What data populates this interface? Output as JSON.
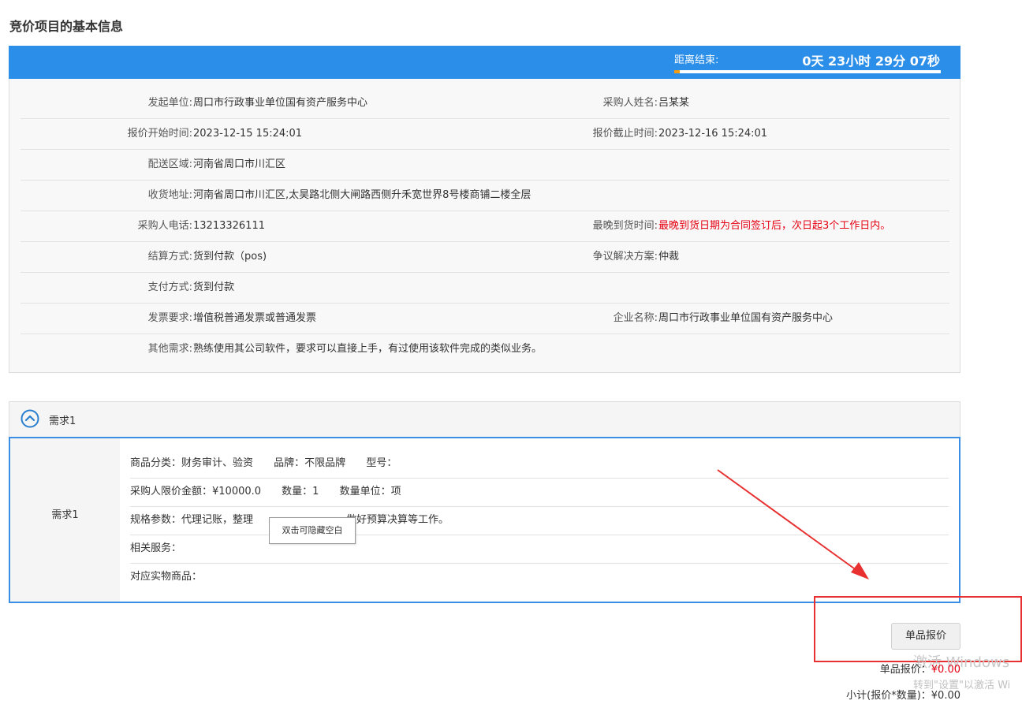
{
  "page_title": "竞价项目的基本信息",
  "countdown": {
    "label": "距离结束:",
    "time": "0天 23小时 29分 07秒",
    "elapsed_fraction": 0.02,
    "colors": {
      "banner": "#2b8ee8",
      "progress": "#f39c12"
    }
  },
  "info": [
    {
      "l_label": "发起单位:",
      "l_value": "周口市行政事业单位国有资产服务中心",
      "r_label": "采购人姓名:",
      "r_value": "吕某某"
    },
    {
      "l_label": "报价开始时间:",
      "l_value": "2023-12-15 15:24:01",
      "r_label": "报价截止时间:",
      "r_value": "2023-12-16 15:24:01"
    },
    {
      "l_label": "配送区域:",
      "l_value": "河南省周口市川汇区",
      "r_label": "",
      "r_value": ""
    },
    {
      "l_label": "收货地址:",
      "l_value": "河南省周口市川汇区,太昊路北侧大闸路西侧升禾宽世界8号楼商铺二楼全层",
      "r_label": "",
      "r_value": ""
    },
    {
      "l_label": "采购人电话:",
      "l_value": "13213326111",
      "r_label": "最晚到货时间:",
      "r_value": "最晚到货日期为合同签订后，次日起3个工作日内。"
    },
    {
      "l_label": "结算方式:",
      "l_value": "货到付款（pos)",
      "r_label": "争议解决方案:",
      "r_value": "仲裁"
    },
    {
      "l_label": "支付方式:",
      "l_value": "货到付款",
      "r_label": "",
      "r_value": ""
    },
    {
      "l_label": "发票要求:",
      "l_value": "增值税普通发票或普通发票",
      "r_label": "企业名称:",
      "r_value": "周口市行政事业单位国有资产服务中心"
    },
    {
      "l_label": "其他需求:",
      "l_value": "熟练使用其公司软件，要求可以直接上手，有过使用该软件完成的类似业务。",
      "r_label": "",
      "r_value": ""
    }
  ],
  "requirement": {
    "header": "需求1",
    "left_label": "需求1",
    "row1": {
      "category": "商品分类：财务审计、验资",
      "brand": "品牌：不限品牌",
      "model": "型号："
    },
    "row2": {
      "limit": "采购人限价金额：¥10000.0",
      "qty": "数量：1",
      "unit": "数量单位：项"
    },
    "row3": {
      "spec_a": "规格参数：代理记账，整理",
      "spec_b": "做好预算决算等工作。"
    },
    "row4": "相关服务：",
    "row5": "对应实物商品："
  },
  "tooltip": "双击可隐藏空白",
  "quote_button": "单品报价",
  "price": {
    "unit_label": "单品报价：",
    "unit_value": "¥0.00",
    "subtotal_label": "小计(报价*数量)：",
    "subtotal_value": "¥0.00"
  },
  "watermark": {
    "line1": "激活 Windows",
    "line2": "转到\"设置\"以激活 Wi"
  },
  "annotation_color": "#e83030"
}
